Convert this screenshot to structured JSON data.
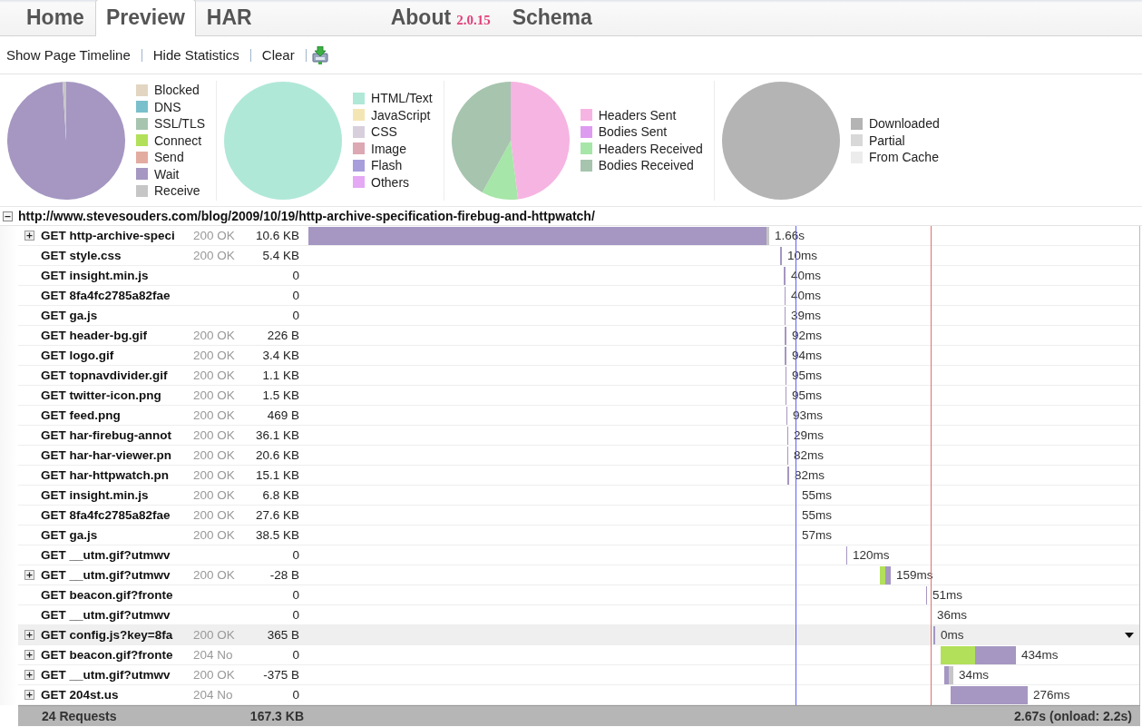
{
  "tabs": [
    {
      "label": "Home",
      "selected": false
    },
    {
      "label": "Preview",
      "selected": true
    },
    {
      "label": "HAR",
      "selected": false
    },
    {
      "label": "About",
      "version": "2.0.15",
      "selected": false
    },
    {
      "label": "Schema",
      "selected": false
    }
  ],
  "toolbar": [
    "Show Page Timeline",
    "Hide Statistics",
    "Clear"
  ],
  "stats": [
    {
      "legend": [
        {
          "label": "Blocked",
          "color": "#e2d6c2"
        },
        {
          "label": "DNS",
          "color": "#7ac0cc"
        },
        {
          "label": "SSL/TLS",
          "color": "#a6c4ae"
        },
        {
          "label": "Connect",
          "color": "#b2e05a"
        },
        {
          "label": "Send",
          "color": "#e3aca0"
        },
        {
          "label": "Wait",
          "color": "#a597c2"
        },
        {
          "label": "Receive",
          "color": "#c6c6c6"
        }
      ]
    },
    {
      "legend": [
        {
          "label": "HTML/Text",
          "color": "#b0e8d8"
        },
        {
          "label": "JavaScript",
          "color": "#f4e6b4"
        },
        {
          "label": "CSS",
          "color": "#d8cfdc"
        },
        {
          "label": "Image",
          "color": "#dca8b4"
        },
        {
          "label": "Flash",
          "color": "#a89edc"
        },
        {
          "label": "Others",
          "color": "#e4a8f4"
        }
      ]
    },
    {
      "legend": [
        {
          "label": "Headers Sent",
          "color": "#f6b4e2"
        },
        {
          "label": "Bodies Sent",
          "color": "#de9cf0"
        },
        {
          "label": "Headers Received",
          "color": "#a6e6a8"
        },
        {
          "label": "Bodies Received",
          "color": "#a6c4ae"
        }
      ]
    },
    {
      "legend": [
        {
          "label": "Downloaded",
          "color": "#b4b4b4"
        },
        {
          "label": "Partial",
          "color": "#d8d8d8"
        },
        {
          "label": "From Cache",
          "color": "#ececec"
        }
      ]
    }
  ],
  "page": {
    "url": "http://www.stevesouders.com/blog/2009/10/19/http-archive-specification-firebug-and-httpwatch/",
    "expanded": true
  },
  "requests": [
    {
      "name": "GET http-archive-speci",
      "status": "200 OK",
      "size": "10.6 KB",
      "time": "1.66s",
      "expandable": true,
      "selected": false
    },
    {
      "name": "GET style.css",
      "status": "200 OK",
      "size": "5.4 KB",
      "time": "10ms",
      "expandable": false,
      "selected": false
    },
    {
      "name": "GET insight.min.js",
      "size": "0",
      "time": "40ms",
      "expandable": false,
      "selected": false
    },
    {
      "name": "GET 8fa4fc2785a82fae",
      "size": "0",
      "time": "40ms",
      "expandable": false,
      "selected": false
    },
    {
      "name": "GET ga.js",
      "size": "0",
      "time": "39ms",
      "expandable": false,
      "selected": false
    },
    {
      "name": "GET header-bg.gif",
      "status": "200 OK",
      "size": "226 B",
      "time": "92ms",
      "expandable": false,
      "selected": false
    },
    {
      "name": "GET logo.gif",
      "status": "200 OK",
      "size": "3.4 KB",
      "time": "94ms",
      "expandable": false,
      "selected": false
    },
    {
      "name": "GET topnavdivider.gif",
      "status": "200 OK",
      "size": "1.1 KB",
      "time": "95ms",
      "expandable": false,
      "selected": false
    },
    {
      "name": "GET twitter-icon.png",
      "status": "200 OK",
      "size": "1.5 KB",
      "time": "95ms",
      "expandable": false,
      "selected": false
    },
    {
      "name": "GET feed.png",
      "status": "200 OK",
      "size": "469 B",
      "time": "93ms",
      "expandable": false,
      "selected": false
    },
    {
      "name": "GET har-firebug-annot",
      "status": "200 OK",
      "size": "36.1 KB",
      "time": "29ms",
      "expandable": false,
      "selected": false
    },
    {
      "name": "GET har-har-viewer.pn",
      "status": "200 OK",
      "size": "20.6 KB",
      "time": "82ms",
      "expandable": false,
      "selected": false
    },
    {
      "name": "GET har-httpwatch.pn",
      "status": "200 OK",
      "size": "15.1 KB",
      "time": "82ms",
      "expandable": false,
      "selected": false
    },
    {
      "name": "GET insight.min.js",
      "status": "200 OK",
      "size": "6.8 KB",
      "time": "55ms",
      "expandable": false,
      "selected": false
    },
    {
      "name": "GET 8fa4fc2785a82fae",
      "status": "200 OK",
      "size": "27.6 KB",
      "time": "55ms",
      "expandable": false,
      "selected": false
    },
    {
      "name": "GET ga.js",
      "status": "200 OK",
      "size": "38.5 KB",
      "time": "57ms",
      "expandable": false,
      "selected": false
    },
    {
      "name": "GET __utm.gif?utmwv",
      "size": "0",
      "time": "120ms",
      "expandable": false,
      "selected": false
    },
    {
      "name": "GET __utm.gif?utmwv",
      "status": "200 OK",
      "size": "-28 B",
      "time": "159ms",
      "expandable": true,
      "selected": false
    },
    {
      "name": "GET beacon.gif?fronte",
      "size": "0",
      "time": "51ms",
      "expandable": false,
      "selected": false
    },
    {
      "name": "GET __utm.gif?utmwv",
      "size": "0",
      "time": "36ms",
      "expandable": false,
      "selected": false
    },
    {
      "name": "GET config.js?key=8fa",
      "status": "200 OK",
      "size": "365 B",
      "time": "0ms",
      "expandable": true,
      "selected": true
    },
    {
      "name": "GET beacon.gif?fronte",
      "status": "204 No",
      "size": "0",
      "time": "434ms",
      "expandable": true,
      "selected": false
    },
    {
      "name": "GET __utm.gif?utmwv",
      "status": "200 OK",
      "size": "-375 B",
      "time": "34ms",
      "expandable": true,
      "selected": false
    },
    {
      "name": "GET 204st.us",
      "status": "204 No",
      "size": "0",
      "time": "276ms",
      "expandable": true,
      "selected": false
    }
  ],
  "summary": {
    "count": "24 Requests",
    "size": "167.3 KB",
    "time": "2.67s (onload: 2.2s)"
  }
}
